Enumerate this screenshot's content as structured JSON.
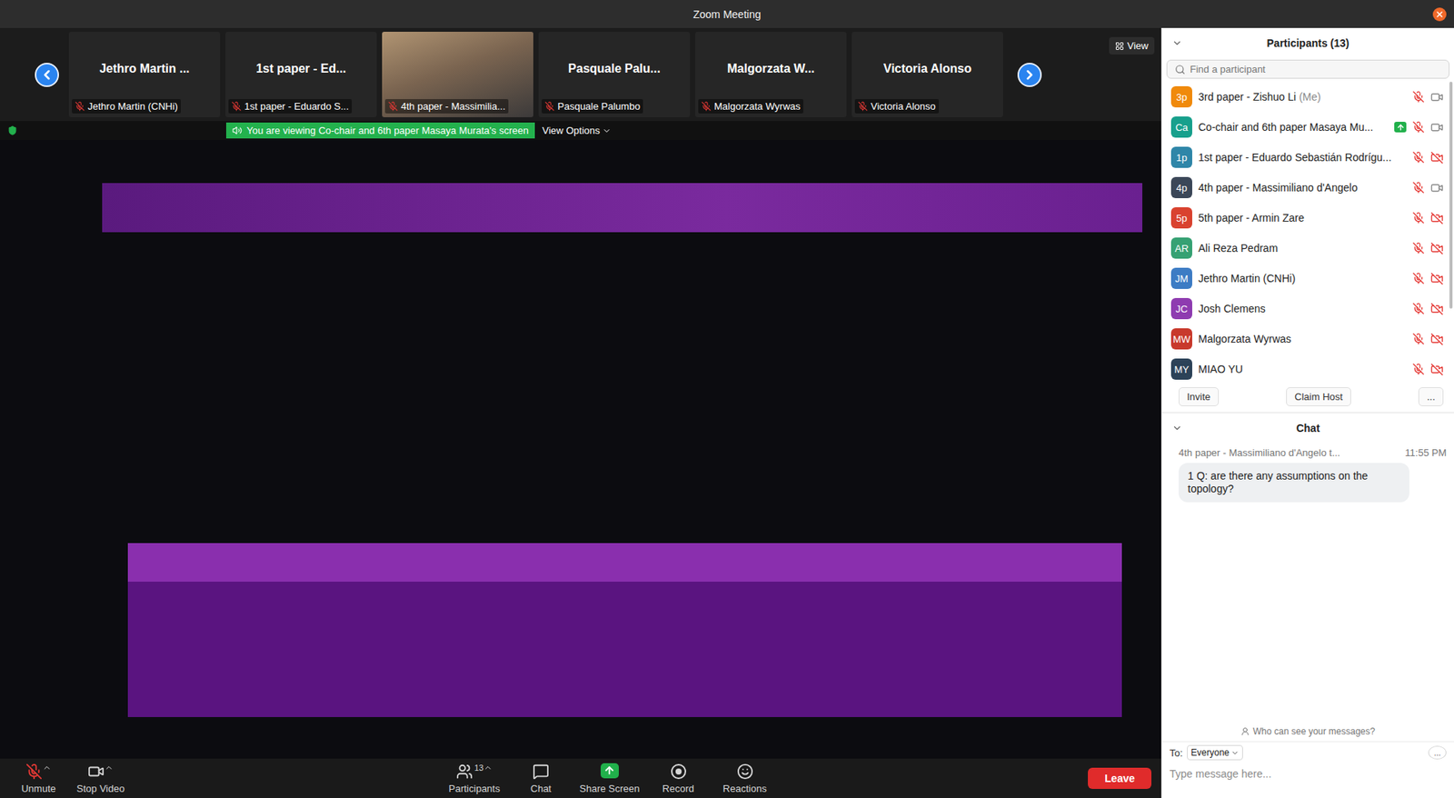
{
  "window": {
    "title": "Zoom Meeting"
  },
  "thumbnails": {
    "view_button": "View",
    "items": [
      {
        "name": "Jethro Martin ...",
        "label": "Jethro Martin (CNHi)",
        "kind": "name",
        "muted": true
      },
      {
        "name": "1st paper - Ed...",
        "label": "1st paper - Eduardo S...",
        "kind": "name",
        "muted": true
      },
      {
        "name": "",
        "label": "4th paper - Massimilia...",
        "kind": "video",
        "muted": true
      },
      {
        "name": "Pasquale Palu...",
        "label": "Pasquale Palumbo",
        "kind": "name",
        "muted": true
      },
      {
        "name": "Malgorzata W...",
        "label": "Malgorzata Wyrwas",
        "kind": "name",
        "muted": true
      },
      {
        "name": "Victoria Alonso",
        "label": "Victoria Alonso",
        "kind": "name",
        "muted": true
      }
    ]
  },
  "banner": {
    "text": "You are viewing Co-chair and 6th paper Masaya Murata's screen",
    "options": "View Options"
  },
  "participants": {
    "title": "Participants (13)",
    "search_placeholder": "Find a participant",
    "rows": [
      {
        "initials": "3p",
        "name": "3rd paper - Zishuo Li",
        "me_tag": "(Me)",
        "color": "#f08a0c",
        "muted": true,
        "video_off": false,
        "sharing": false
      },
      {
        "initials": "Ca",
        "name": "Co-chair and 6th paper Masaya Mu...",
        "me_tag": "",
        "color": "#17a08c",
        "muted": true,
        "video_off": false,
        "sharing": true
      },
      {
        "initials": "1p",
        "name": "1st paper - Eduardo Sebastián Rodrígu...",
        "me_tag": "",
        "color": "#2f86a8",
        "muted": true,
        "video_off": true,
        "sharing": false
      },
      {
        "initials": "4p",
        "name": "4th paper - Massimiliano d'Angelo",
        "me_tag": "",
        "color": "#3b4758",
        "muted": true,
        "video_off": false,
        "sharing": false
      },
      {
        "initials": "5p",
        "name": "5th paper - Armin Zare",
        "me_tag": "",
        "color": "#d9422f",
        "muted": true,
        "video_off": true,
        "sharing": false
      },
      {
        "initials": "AR",
        "name": "Ali Reza Pedram",
        "me_tag": "",
        "color": "#36a173",
        "muted": true,
        "video_off": true,
        "sharing": false
      },
      {
        "initials": "JM",
        "name": "Jethro Martin (CNHi)",
        "me_tag": "",
        "color": "#3d7cc4",
        "muted": true,
        "video_off": true,
        "sharing": false
      },
      {
        "initials": "JC",
        "name": "Josh Clemens",
        "me_tag": "",
        "color": "#8e3bb0",
        "muted": true,
        "video_off": true,
        "sharing": false
      },
      {
        "initials": "MW",
        "name": "Malgorzata Wyrwas",
        "me_tag": "",
        "color": "#c8392c",
        "muted": true,
        "video_off": true,
        "sharing": false
      },
      {
        "initials": "MY",
        "name": "MIAO YU",
        "me_tag": "",
        "color": "#2c4258",
        "muted": true,
        "video_off": true,
        "sharing": false
      }
    ],
    "buttons": [
      "Invite",
      "Claim Host",
      "..."
    ]
  },
  "chat": {
    "title": "Chat",
    "messages": [
      {
        "sender": "4th paper - Massimiliano d'Angelo t...",
        "time": "11:55 PM",
        "text": "1 Q: are there any assumptions on the topology?"
      }
    ],
    "visibility": "Who can see your messages?",
    "to_label": "To:",
    "recipient": "Everyone",
    "more": "...",
    "placeholder": "Type message here..."
  },
  "toolbar": {
    "items": [
      {
        "label": "Unmute",
        "kind": "mic",
        "count": "",
        "caret": true
      },
      {
        "label": "Stop Video",
        "kind": "video",
        "count": "",
        "caret": true
      },
      {
        "label": "Participants",
        "kind": "participants",
        "count": "13",
        "caret": true
      },
      {
        "label": "Chat",
        "kind": "chat",
        "count": "",
        "caret": false
      },
      {
        "label": "Share Screen",
        "kind": "share",
        "count": "",
        "caret": false
      },
      {
        "label": "Record",
        "kind": "record",
        "count": "",
        "caret": false
      },
      {
        "label": "Reactions",
        "kind": "reactions",
        "count": "",
        "caret": false
      }
    ],
    "leave": "Leave"
  }
}
